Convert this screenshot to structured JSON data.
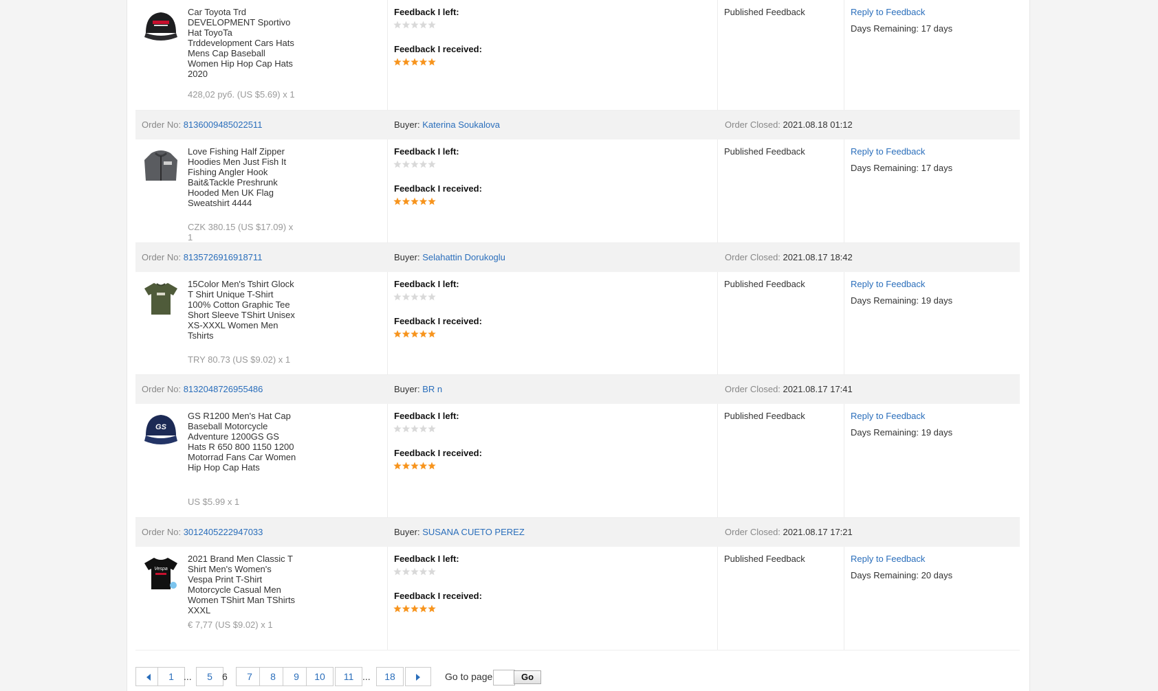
{
  "labels": {
    "order_no": "Order No:",
    "buyer": "Buyer:",
    "order_closed": "Order Closed:",
    "feedback_left": "Feedback I left:",
    "feedback_received": "Feedback I received:",
    "status": "Published Feedback",
    "reply": "Reply to Feedback"
  },
  "orders": [
    {
      "title": "Car Toyota Trd DEVELOPMENT Sportivo Hat ToyoTa Trddevelopment Cars Hats Mens Cap Baseball Women Hip Hop Cap Hats 2020",
      "price": "428,02 руб. (US $5.69) x 1",
      "days_remaining": "Days Remaining: 17 days",
      "feedback_left_stars": 0,
      "feedback_received_stars": 5,
      "thumb_icon": "black-cap-icon"
    },
    {
      "order_no": "8136009485022511",
      "buyer": "Katerina Soukalova",
      "closed": "2021.08.18 01:12",
      "title": "Love Fishing Half Zipper Hoodies Men Just Fish It Fishing Angler Hook Bait&Tackle Preshrunk Hooded Men UK Flag Sweatshirt 4444",
      "price": "CZK 380.15 (US $17.09) x 1",
      "days_remaining": "Days Remaining: 17 days",
      "feedback_left_stars": 0,
      "feedback_received_stars": 5,
      "thumb_icon": "grey-hoodie-icon"
    },
    {
      "order_no": "8135726916918711",
      "buyer": "Selahattin Dorukoglu",
      "closed": "2021.08.17 18:42",
      "title": "15Color Men's Tshirt Glock T Shirt Unique T-Shirt 100% Cotton Graphic Tee Short Sleeve TShirt Unisex XS-XXXL Women Men Tshirts",
      "price": "TRY 80.73 (US $9.02) x 1",
      "days_remaining": "Days Remaining: 19 days",
      "feedback_left_stars": 0,
      "feedback_received_stars": 5,
      "thumb_icon": "green-tshirt-icon"
    },
    {
      "order_no": "8132048726955486",
      "buyer": "BR n",
      "closed": "2021.08.17 17:41",
      "title": "GS R1200 Men's Hat Cap Baseball Motorcycle Adventure 1200GS GS Hats R 650 800 1150 1200 Motorrad Fans Car Women Hip Hop Cap Hats",
      "price": "US $5.99 x 1",
      "days_remaining": "Days Remaining: 19 days",
      "feedback_left_stars": 0,
      "feedback_received_stars": 5,
      "thumb_icon": "navy-gs-cap-icon"
    },
    {
      "order_no": "3012405222947033",
      "buyer": "SUSANA CUETO PEREZ",
      "closed": "2021.08.17 17:21",
      "title": "2021 Brand Men Classic T Shirt Men's Women's Vespa Print T-Shirt Motorcycle Casual Men Women TShirt Man TShirts XXXL",
      "price": "€ 7,77 (US $9.02) x 1",
      "days_remaining": "Days Remaining: 20 days",
      "feedback_left_stars": 0,
      "feedback_received_stars": 5,
      "thumb_icon": "black-vespa-tshirt-icon"
    }
  ],
  "pagination": {
    "pages": [
      "1",
      "5",
      "6",
      "7",
      "8",
      "9",
      "10",
      "11",
      "18"
    ],
    "current": "6",
    "ellipsis": "...",
    "goto_label": "Go to page",
    "go_button": "Go",
    "goto_value": ""
  },
  "colors": {
    "link": "#2a6ebb",
    "star_filled": "#f7941d",
    "star_empty": "#d9d9d9",
    "header_bg": "#f2f2f2"
  }
}
